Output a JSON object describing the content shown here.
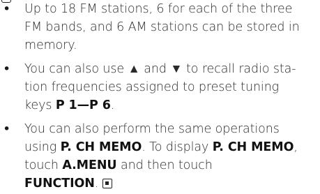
{
  "notes": [
    {
      "lines": [
        [
          "Up to 18 FM stations, 6 for each of the three"
        ],
        [
          "FM bands, and 6 AM stations can be stored in"
        ],
        [
          "memory."
        ]
      ]
    },
    {
      "lines": [
        [
          "You can also use ▲ and ▼ to recall radio sta-"
        ],
        [
          "tion frequencies assigned to preset tuning"
        ],
        [
          "keys ",
          "P 1—P 6",
          "."
        ]
      ]
    },
    {
      "lines": [
        [
          "You can also perform the same operations"
        ],
        [
          "using ",
          "P. CH MEMO",
          ". To display ",
          "P. CH MEMO",
          ","
        ],
        [
          "touch ",
          "A.MENU",
          " and then touch"
        ],
        [
          "FUNCTION",
          "."
        ]
      ]
    }
  ],
  "icons": {
    "top_marker": "section-end-marker-icon",
    "end_mark": "end-of-section-icon"
  }
}
